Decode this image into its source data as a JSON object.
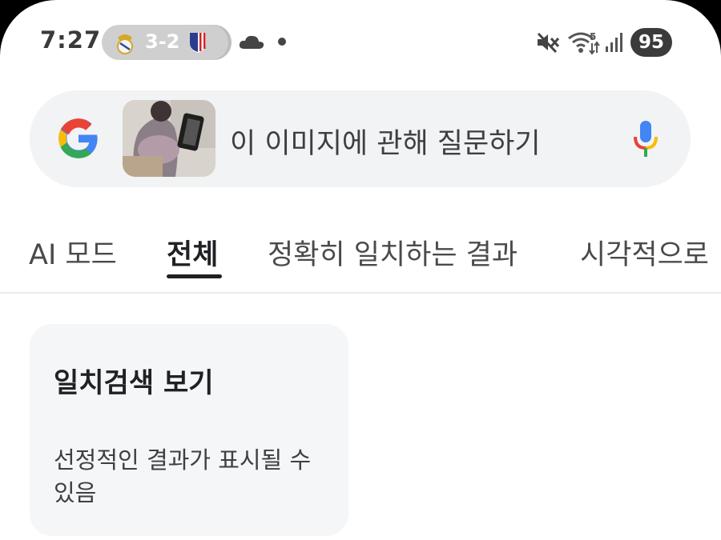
{
  "status_bar": {
    "time": "7:27",
    "score": "3-2",
    "battery": "95",
    "icons": [
      "real-madrid-crest-icon",
      "atletico-crest-icon",
      "cloud-icon",
      "notification-dot-icon",
      "mute-icon",
      "wifi-icon",
      "signal-icon"
    ]
  },
  "search": {
    "placeholder": "이 이미지에 관해 질문하기",
    "icons": [
      "google-g-icon",
      "mic-icon"
    ],
    "colors": {
      "bar_bg": "#f1f3f4",
      "text": "#3c4043"
    }
  },
  "tabs": [
    {
      "label": "AI 모드"
    },
    {
      "label": "전체",
      "active": true
    },
    {
      "label": "정확히 일치하는 결과"
    },
    {
      "label": "시각적으로"
    }
  ],
  "card": {
    "title": "일치검색 보기",
    "description": "선정적인 결과가 표시될 수 있음"
  }
}
